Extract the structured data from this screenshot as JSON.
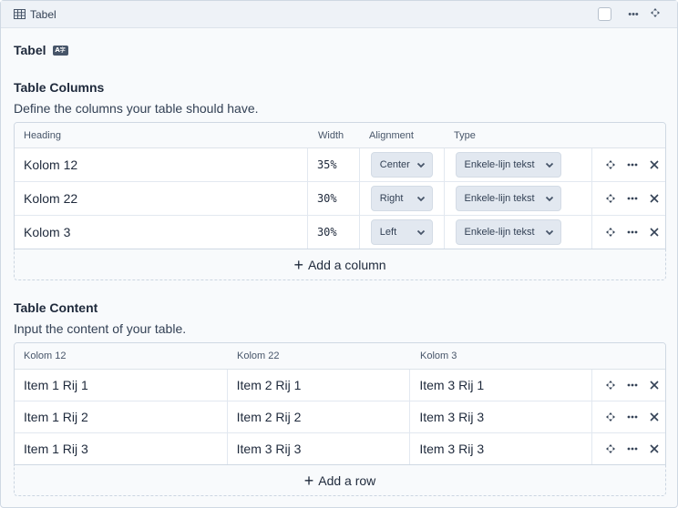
{
  "header": {
    "title": "Tabel"
  },
  "field": {
    "label": "Tabel",
    "badge_text": "A"
  },
  "columns_section": {
    "title": "Table Columns",
    "description": "Define the columns your table should have.",
    "headers": {
      "heading": "Heading",
      "width": "Width",
      "alignment": "Alignment",
      "type": "Type"
    },
    "rows": [
      {
        "heading": "Kolom 12",
        "width": "35%",
        "alignment": "Center",
        "type": "Enkele-lijn tekst"
      },
      {
        "heading": "Kolom 22",
        "width": "30%",
        "alignment": "Right",
        "type": "Enkele-lijn tekst"
      },
      {
        "heading": "Kolom 3",
        "width": "30%",
        "alignment": "Left",
        "type": "Enkele-lijn tekst"
      }
    ],
    "add_label": "Add a column"
  },
  "content_section": {
    "title": "Table Content",
    "description": "Input the content of your table.",
    "headers": [
      "Kolom 12",
      "Kolom 22",
      "Kolom 3"
    ],
    "rows": [
      [
        "Item 1 Rij 1",
        "Item 2 Rij 1",
        "Item 3 Rij 1"
      ],
      [
        "Item 1 Rij 2",
        "Item 2 Rij 2",
        "Item 3 Rij 3"
      ],
      [
        "Item 1 Rij 3",
        "Item 3 Rij 3",
        "Item 3 Rij 3"
      ]
    ],
    "add_label": "Add a row"
  }
}
